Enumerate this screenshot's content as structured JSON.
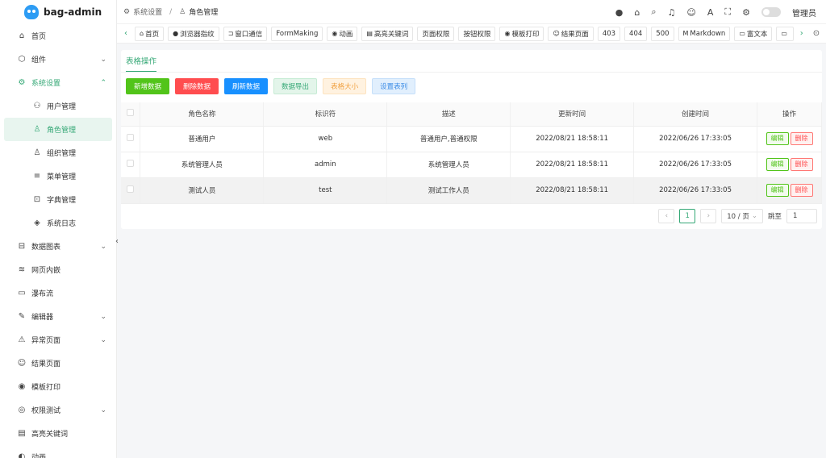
{
  "app": {
    "name": "bag-admin"
  },
  "sidebar": {
    "items": [
      {
        "label": "首页",
        "icon": "home-icon",
        "glyph": "⌂"
      },
      {
        "label": "组件",
        "icon": "cube-icon",
        "glyph": "⬡",
        "arrow": "⌄"
      },
      {
        "label": "系统设置",
        "icon": "gear-icon",
        "glyph": "⚙",
        "arrow": "⌃",
        "active": true
      }
    ],
    "subitems": [
      {
        "label": "用户管理",
        "icon": "users-icon",
        "glyph": "⚇"
      },
      {
        "label": "角色管理",
        "icon": "user-icon",
        "glyph": "♙",
        "active": true
      },
      {
        "label": "组织管理",
        "icon": "org-icon",
        "glyph": "♙"
      },
      {
        "label": "菜单管理",
        "icon": "menu-icon",
        "glyph": "≡"
      },
      {
        "label": "字典管理",
        "icon": "book-icon",
        "glyph": "⊡"
      },
      {
        "label": "系统日志",
        "icon": "log-icon",
        "glyph": "◈"
      }
    ],
    "items2": [
      {
        "label": "数据图表",
        "icon": "chart-icon",
        "glyph": "⊟",
        "arrow": "⌄"
      },
      {
        "label": "网页内嵌",
        "icon": "layers-icon",
        "glyph": "≋"
      },
      {
        "label": "瀑布流",
        "icon": "monitor-icon",
        "glyph": "▭"
      },
      {
        "label": "编辑器",
        "icon": "edit-icon",
        "glyph": "✎",
        "arrow": "⌄"
      },
      {
        "label": "异常页面",
        "icon": "bug-icon",
        "glyph": "⚠",
        "arrow": "⌄"
      },
      {
        "label": "结果页面",
        "icon": "smile-icon",
        "glyph": "☺"
      },
      {
        "label": "模板打印",
        "icon": "print-icon",
        "glyph": "◉"
      },
      {
        "label": "权限测试",
        "icon": "lock-icon",
        "glyph": "◎",
        "arrow": "⌄"
      },
      {
        "label": "高亮关键词",
        "icon": "highlight-icon",
        "glyph": "▤"
      },
      {
        "label": "动画",
        "icon": "animation-icon",
        "glyph": "◐"
      }
    ]
  },
  "header": {
    "breadcrumb": [
      "系统设置",
      "角色管理"
    ],
    "user": "管理员"
  },
  "tabs": [
    {
      "label": "首页",
      "glyph": "⌂"
    },
    {
      "label": "浏览器指纹",
      "glyph": "●"
    },
    {
      "label": "窗口通信",
      "glyph": "⊐"
    },
    {
      "label": "FormMaking",
      "glyph": ""
    },
    {
      "label": "动画",
      "glyph": "◉"
    },
    {
      "label": "高亮关键词",
      "glyph": "▤"
    },
    {
      "label": "页面权限",
      "glyph": ""
    },
    {
      "label": "按钮权限",
      "glyph": ""
    },
    {
      "label": "模板打印",
      "glyph": "◉"
    },
    {
      "label": "结果页面",
      "glyph": "☺"
    },
    {
      "label": "403",
      "glyph": ""
    },
    {
      "label": "404",
      "glyph": ""
    },
    {
      "label": "500",
      "glyph": ""
    },
    {
      "label": "Markdown",
      "glyph": "M"
    },
    {
      "label": "富文本",
      "glyph": "▭"
    },
    {
      "label": "",
      "glyph": "▭"
    }
  ],
  "card": {
    "tab_label": "表格操作",
    "buttons": {
      "add": "新增数据",
      "delete": "删除数据",
      "refresh": "刷新数据",
      "export": "数据导出",
      "size": "表格大小",
      "columns": "设置表列"
    },
    "columns": [
      "角色名称",
      "标识符",
      "描述",
      "更新时间",
      "创建时间",
      "操作"
    ],
    "rows": [
      {
        "name": "普通用户",
        "code": "web",
        "desc": "普通用户,普通权限",
        "updated": "2022/08/21 18:58:11",
        "created": "2022/06/26 17:33:05"
      },
      {
        "name": "系统管理人员",
        "code": "admin",
        "desc": "系统管理人员",
        "updated": "2022/08/21 18:58:11",
        "created": "2022/06/26 17:33:05"
      },
      {
        "name": "测试人员",
        "code": "test",
        "desc": "测试工作人员",
        "updated": "2022/08/21 18:58:11",
        "created": "2022/06/26 17:33:05"
      }
    ],
    "row_actions": {
      "edit": "编辑",
      "delete": "删除"
    },
    "pager": {
      "current": "1",
      "page_size": "10 / 页",
      "jump_label": "跳至",
      "jump_value": "1"
    }
  },
  "colors": {
    "accent": "#35a876",
    "danger": "#ff4d4f",
    "primary": "#1890ff",
    "success": "#52c41a"
  }
}
